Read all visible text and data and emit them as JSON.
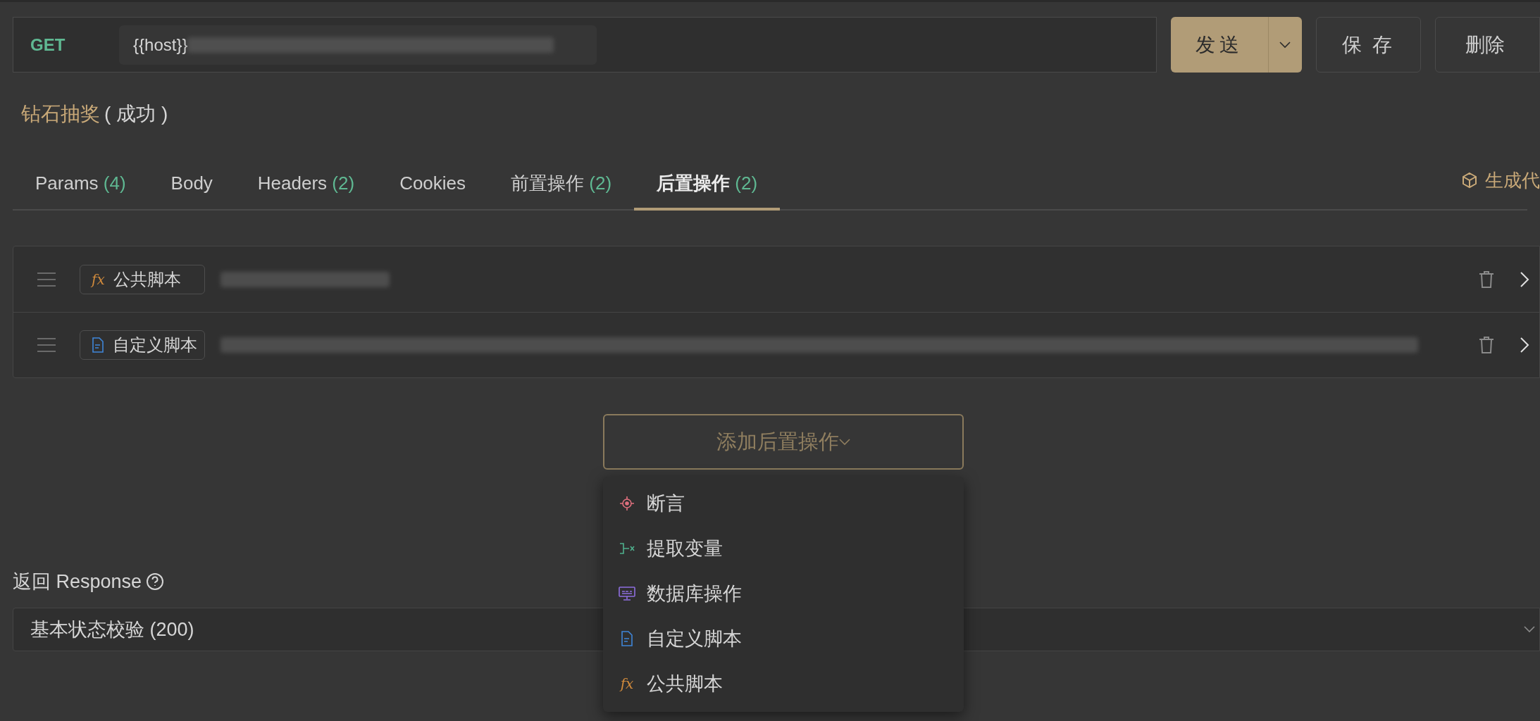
{
  "request": {
    "method": "GET",
    "url": "{{host}}"
  },
  "actions": [
    {
      "label": "发送"
    },
    {
      "label": "保 存"
    },
    {
      "label": "删除"
    }
  ],
  "title": {
    "name": "钻石抽奖",
    "status": "( 成功 )"
  },
  "tabs": [
    {
      "label": "Params",
      "count": "(4)",
      "selected": false
    },
    {
      "label": "Body",
      "selected": false
    },
    {
      "label": "Headers",
      "count": "(2)",
      "selected": false
    },
    {
      "label": "Cookies",
      "selected": false
    },
    {
      "label": "前置操作",
      "count": "(2)",
      "selected": false
    },
    {
      "label": "后置操作",
      "count": "(2)",
      "selected": true
    }
  ],
  "generate_code": "生成代",
  "post_operations": [
    {
      "kind": "fx",
      "label": "公共脚本"
    },
    {
      "kind": "script",
      "label": "自定义脚本"
    }
  ],
  "add_button": "添加后置操作",
  "add_menu": [
    {
      "kind": "assert",
      "label": "断言"
    },
    {
      "kind": "extract",
      "label": "提取变量"
    },
    {
      "kind": "sql",
      "label": "数据库操作"
    },
    {
      "kind": "script",
      "label": "自定义脚本"
    },
    {
      "kind": "fx",
      "label": "公共脚本"
    }
  ],
  "response": {
    "label": "返回 Response",
    "value": "基本状态校验 (200)"
  }
}
